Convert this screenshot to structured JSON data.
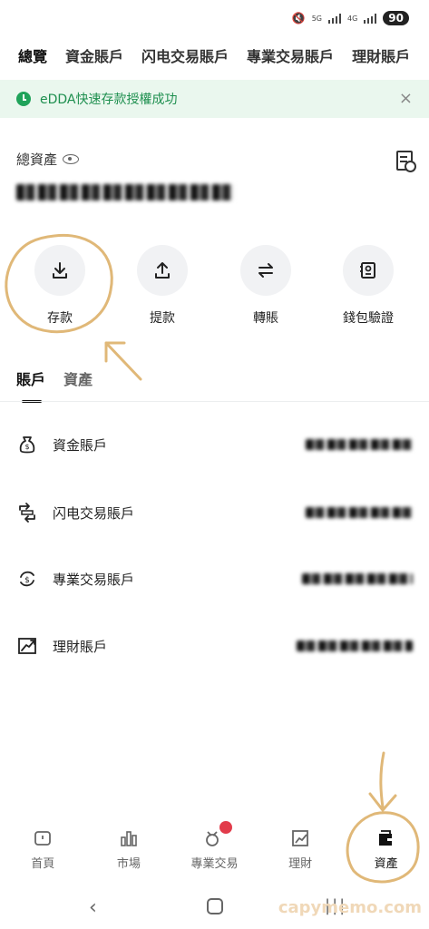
{
  "status": {
    "battery": "90",
    "sig1": "5G",
    "sig2": "4G"
  },
  "top_tabs": [
    {
      "label": "總覽",
      "active": true
    },
    {
      "label": "資金賬戶"
    },
    {
      "label": "闪电交易賬戶"
    },
    {
      "label": "專業交易賬戶"
    },
    {
      "label": "理財賬戶"
    }
  ],
  "banner": {
    "text": "eDDA快速存款授權成功",
    "close": "×"
  },
  "total": {
    "label": "總資產"
  },
  "actions": [
    {
      "label": "存款",
      "icon": "download-icon"
    },
    {
      "label": "提款",
      "icon": "upload-icon"
    },
    {
      "label": "轉賬",
      "icon": "transfer-icon"
    },
    {
      "label": "錢包驗證",
      "icon": "wallet-verify-icon"
    }
  ],
  "section_tabs": [
    {
      "label": "賬戶",
      "active": true
    },
    {
      "label": "資產"
    }
  ],
  "accounts": [
    {
      "label": "資金賬戶",
      "icon": "money-bag-icon"
    },
    {
      "label": "闪电交易賬戶",
      "icon": "swap-icon"
    },
    {
      "label": "專業交易賬戶",
      "icon": "exchange-icon"
    },
    {
      "label": "理財賬戶",
      "icon": "growth-chart-icon"
    }
  ],
  "bottom_nav": [
    {
      "label": "首頁",
      "icon": "home-icon"
    },
    {
      "label": "市場",
      "icon": "market-icon"
    },
    {
      "label": "專業交易",
      "icon": "trade-icon"
    },
    {
      "label": "理財",
      "icon": "finance-icon"
    },
    {
      "label": "資產",
      "icon": "wallet-icon",
      "active": true
    }
  ],
  "watermark": "capymemo.com"
}
